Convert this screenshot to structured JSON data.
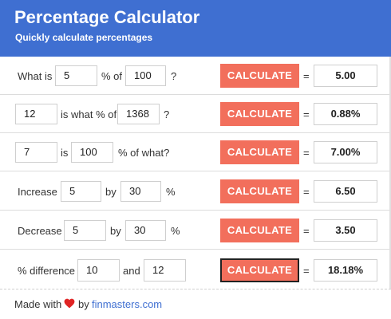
{
  "header": {
    "title": "Percentage Calculator",
    "subtitle": "Quickly calculate percentages"
  },
  "calculate_label": "CALCULATE",
  "equals": "=",
  "rows": [
    {
      "label_a": "What is",
      "input_1": "5",
      "label_b": "% of",
      "input_2": "100",
      "label_c": "?",
      "result": "5.00"
    },
    {
      "input_1": "12",
      "label_a": "is what % of",
      "input_2": "1368",
      "label_b": "?",
      "result": "0.88%"
    },
    {
      "input_1": "7",
      "label_a": "is",
      "input_2": "100",
      "label_b": "% of what?",
      "result": "7.00%"
    },
    {
      "label_a": "Increase",
      "input_1": "5",
      "label_b": "by",
      "input_2": "30",
      "label_c": "%",
      "result": "6.50"
    },
    {
      "label_a": "Decrease",
      "input_1": "5",
      "label_b": "by",
      "input_2": "30",
      "label_c": "%",
      "result": "3.50"
    },
    {
      "label_a": "% difference",
      "input_1": "10",
      "label_b": "and",
      "input_2": "12",
      "result": "18.18%"
    }
  ],
  "footer": {
    "made_with": "Made with",
    "by": "by",
    "link": "finmasters.com"
  },
  "colors": {
    "header_bg": "#3f6fd1",
    "button_bg": "#f26f5c",
    "heart": "#e02424"
  }
}
